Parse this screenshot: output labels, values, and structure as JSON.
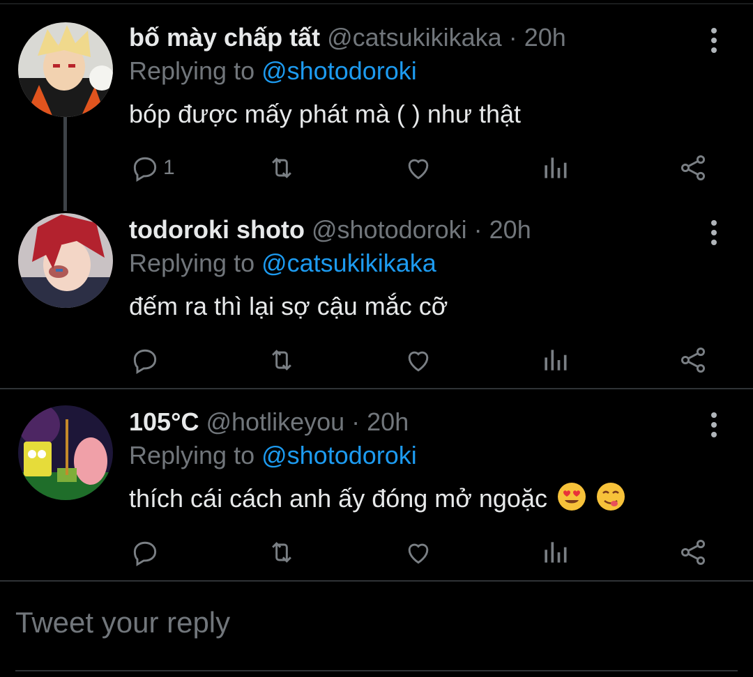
{
  "tweets": [
    {
      "name": "bố mày chấp tất",
      "handle": "@catsukikikaka",
      "time": "· 20h",
      "replying_prefix": "Replying to ",
      "replying_to": "@shotodoroki",
      "text": "bóp được mấy phát mà ( ) như thật",
      "reply_count": "1",
      "avatar": "anime-character-avatar"
    },
    {
      "name": "todoroki shoto",
      "handle": "@shotodoroki",
      "time": "· 20h",
      "replying_prefix": "Replying to ",
      "replying_to": "@catsukikikaka",
      "text": "đếm ra thì lại sợ cậu mắc cỡ",
      "reply_count": "",
      "avatar": "anime-character-avatar"
    },
    {
      "name": "105°C",
      "handle": "@hotlikeyou",
      "time": "· 20h",
      "replying_prefix": "Replying to ",
      "replying_to": "@shotodoroki",
      "text": "thích cái cách anh ấy đóng mở ngoặc",
      "emojis": [
        "heart-eyes-emoji",
        "yum-emoji"
      ],
      "reply_count": "",
      "avatar": "cartoon-avatar"
    }
  ],
  "composer": {
    "placeholder": "Tweet your reply"
  },
  "colors": {
    "background": "#000000",
    "text": "#e7e9ea",
    "muted": "#71767b",
    "accent": "#1d9bf0",
    "divider": "#2f3336"
  }
}
